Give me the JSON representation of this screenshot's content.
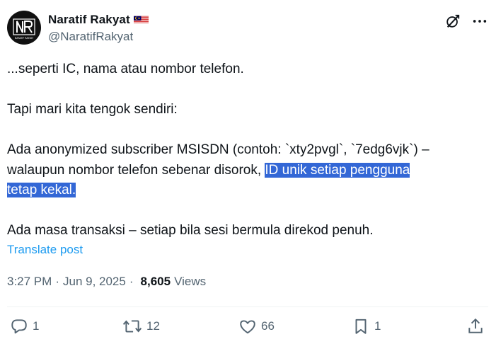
{
  "author": {
    "display_name": "Naratif Rakyat",
    "handle": "@NaratifRakyat",
    "avatar_initials": "NR",
    "flag": "malaysia-flag"
  },
  "body": {
    "para1": "...seperti IC, nama atau nombor telefon.",
    "para2": "Tapi mari kita tengok sendiri:",
    "para3_plain": "Ada anonymized subscriber MSISDN (contoh: `xty2pvgl`, `7edg6vjk`) – walaupun nombor telefon sebenar disorok, ",
    "para3_highlight_1": "ID unik setiap pengguna ",
    "para3_highlight_2": "tetap kekal.",
    "para4": "Ada masa transaksi – setiap bila sesi bermula direkod penuh."
  },
  "translate_label": "Translate post",
  "meta": {
    "time": "3:27 PM",
    "date": "Jun 9, 2025",
    "separator": "·",
    "views_count": "8,605",
    "views_label": "Views"
  },
  "actions": {
    "replies": "1",
    "reposts": "12",
    "likes": "66",
    "bookmarks": "1"
  },
  "colors": {
    "accent": "#1d9bf0",
    "highlight": "#3367d6",
    "secondary_text": "#536471",
    "primary_text": "#0f1419"
  }
}
